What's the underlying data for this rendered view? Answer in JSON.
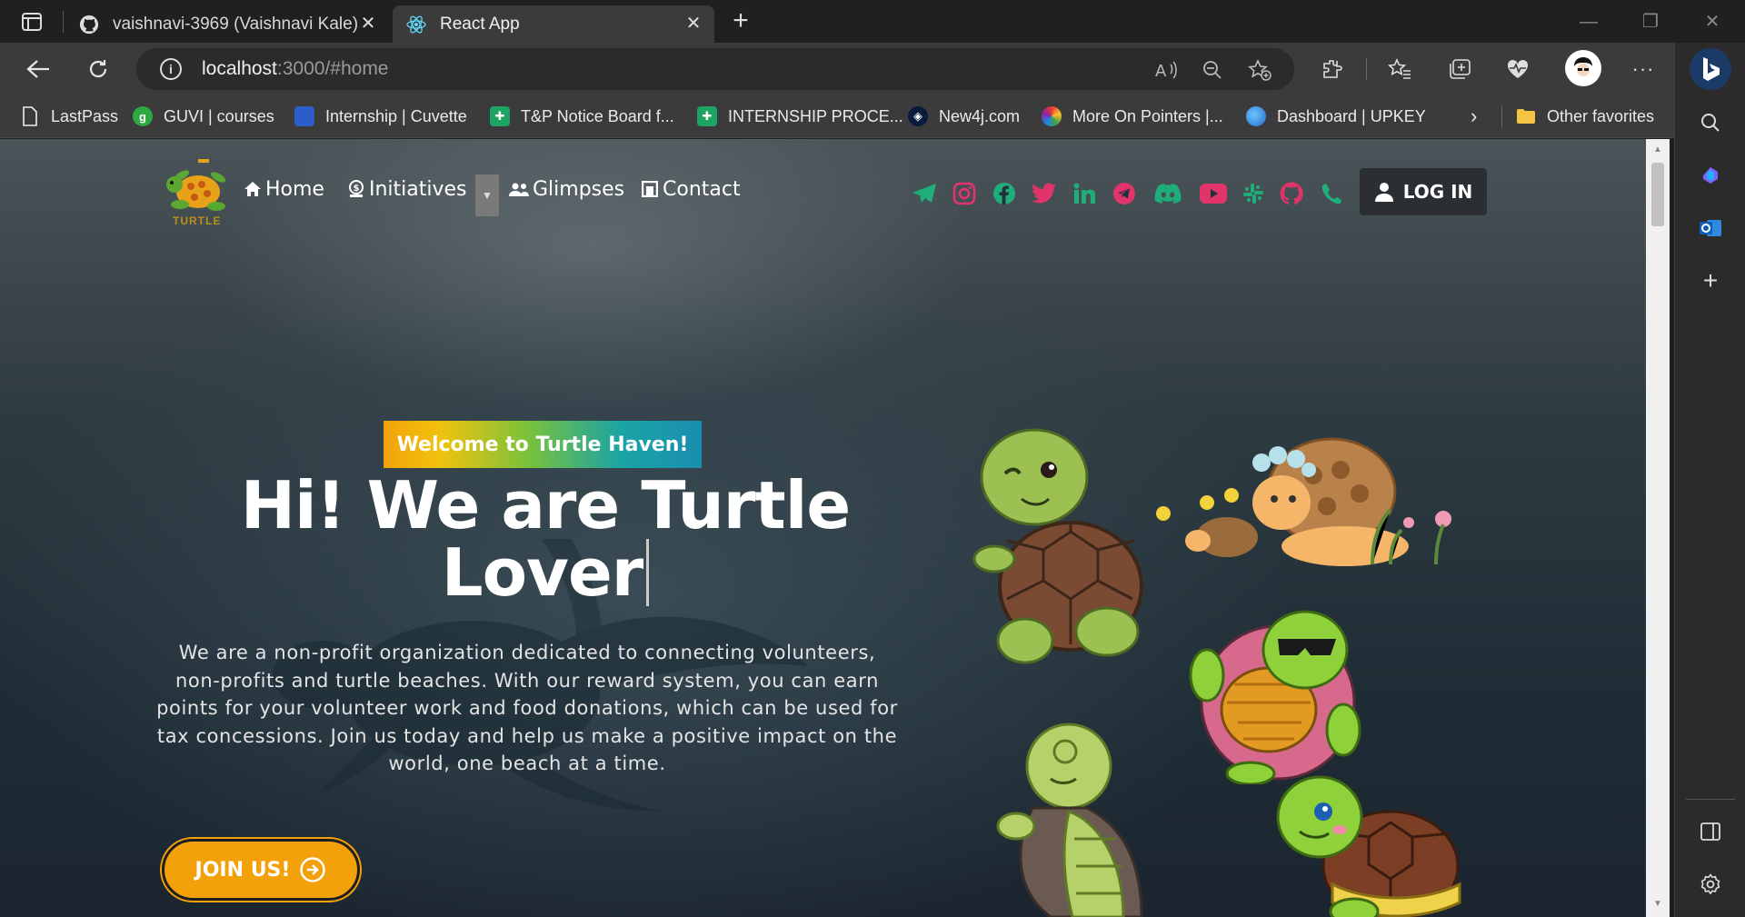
{
  "browser": {
    "tabs": [
      {
        "title": "vaishnavi-3969 (Vaishnavi Kale)",
        "icon": "github-icon",
        "active": false
      },
      {
        "title": "React App",
        "icon": "react-icon",
        "active": true
      }
    ],
    "address": {
      "host": "localhost",
      "rest": ":3000/#home"
    },
    "favorites": [
      {
        "label": "LastPass",
        "icon": "page-icon"
      },
      {
        "label": "GUVI | courses",
        "icon": "guvi-icon"
      },
      {
        "label": "Internship | Cuvette",
        "icon": "cuvette-icon"
      },
      {
        "label": "T&P Notice Board f...",
        "icon": "sheets-icon"
      },
      {
        "label": "INTERNSHIP PROCE...",
        "icon": "sheets-icon"
      },
      {
        "label": "New4j.com",
        "icon": "neo4j-icon"
      },
      {
        "label": "More On Pointers |...",
        "icon": "loader-icon"
      },
      {
        "label": "Dashboard | UPKEY",
        "icon": "cloud-icon"
      }
    ],
    "other_favorites": "Other favorites"
  },
  "site": {
    "logo_text": "TURTLE",
    "nav": [
      {
        "label": "Home",
        "icon": "home-icon"
      },
      {
        "label": "Initiatives",
        "icon": "money-icon"
      },
      {
        "label": "Glimpses",
        "icon": "users-icon"
      },
      {
        "label": "Contact",
        "icon": "contact-icon"
      }
    ],
    "socials": [
      "telegram-plane-icon",
      "instagram-icon",
      "facebook-icon",
      "twitter-icon",
      "linkedin-icon",
      "telegram-icon",
      "discord-icon",
      "youtube-icon",
      "slack-icon",
      "github-icon",
      "phone-icon"
    ],
    "login_label": "LOG IN",
    "accent": "#f2a10b",
    "social_green": "#1fae7a",
    "social_pink": "#e0346a"
  },
  "hero": {
    "badge": "Welcome to Turtle Haven!",
    "title_line1": "Hi! We are Turtle",
    "title_line2": "Lover",
    "description": "We are a non-profit organization dedicated to connecting volunteers, non-profits and turtle beaches. With our reward system, you can earn points for your volunteer work and food donations, which can be used for tax concessions. Join us today and help us make a positive impact on the world, one beach at a time.",
    "cta": "JOIN US!"
  }
}
